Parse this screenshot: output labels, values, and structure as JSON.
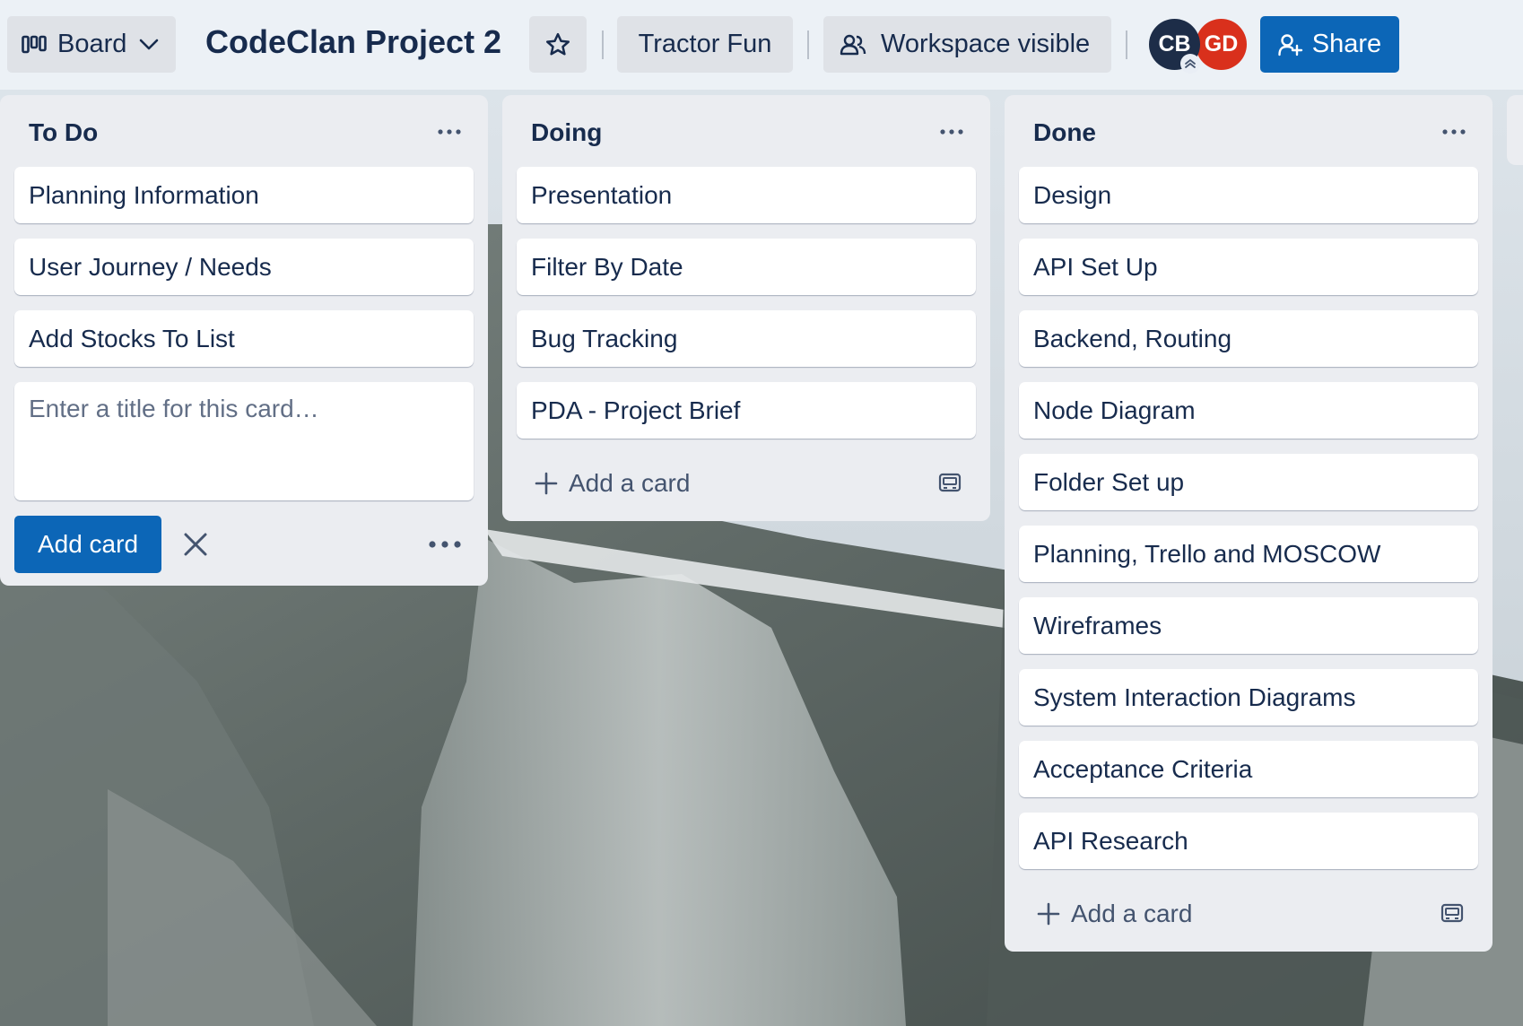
{
  "header": {
    "view_switcher_label": "Board",
    "board_title": "CodeClan Project 2",
    "workspace_name": "Tractor Fun",
    "visibility_label": "Workspace visible",
    "members": [
      {
        "initials": "CB",
        "color": "#1d2d48"
      },
      {
        "initials": "GD",
        "color": "#d9301c"
      }
    ],
    "share_label": "Share"
  },
  "lists": [
    {
      "title": "To Do",
      "cards": [
        "Planning Information",
        "User Journey / Needs",
        "Add Stocks To List"
      ],
      "composer": {
        "placeholder": "Enter a title for this card…",
        "value": "",
        "submit_label": "Add card"
      }
    },
    {
      "title": "Doing",
      "cards": [
        "Presentation",
        "Filter By Date",
        "Bug Tracking",
        "PDA - Project Brief"
      ],
      "add_card_label": "Add a card"
    },
    {
      "title": "Done",
      "cards": [
        "Design",
        "API Set Up",
        "Backend, Routing",
        "Node Diagram",
        "Folder Set up",
        "Planning, Trello and MOSCOW",
        "Wireframes",
        "System Interaction Diagrams",
        "Acceptance Criteria",
        "API Research"
      ],
      "add_card_label": "Add a card"
    }
  ],
  "colors": {
    "primary_button": "#0c66b7",
    "list_background": "#ebedf1",
    "text": "#172b4d"
  }
}
